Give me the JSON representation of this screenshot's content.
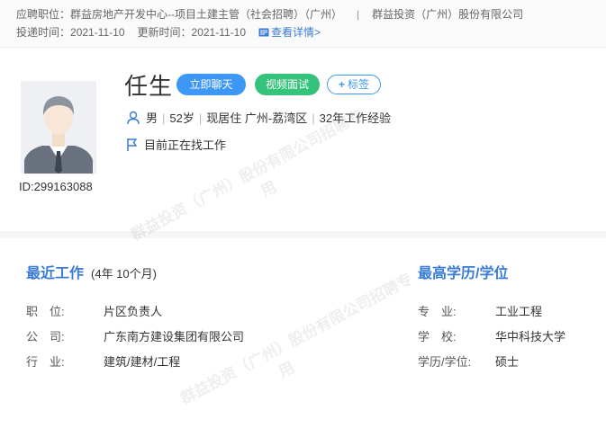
{
  "header": {
    "position_label": "应聘职位：",
    "position_value": "群益房地产开发中心--项目土建主管（社会招聘）（广州）",
    "separator": "|",
    "company": "群益投资（广州）股份有限公司",
    "submit_label": "投递时间：",
    "submit_time": "2021-11-10",
    "update_label": "更新时间：",
    "update_time": "2021-11-10",
    "detail_link": "查看详情>"
  },
  "candidate": {
    "name": "任生",
    "id_text": "ID:299163088",
    "gender": "男",
    "age": "52岁",
    "residence": "现居住 广州-荔湾区",
    "experience": "32年工作经验",
    "status": "目前正在找工作"
  },
  "actions": {
    "chat": "立即聊天",
    "video": "视频面试",
    "tag": "标签"
  },
  "recent_work": {
    "title": "最近工作",
    "duration": "(4年 10个月)",
    "rows": [
      {
        "label": "职　位:",
        "value": "片区负责人"
      },
      {
        "label": "公　司:",
        "value": "广东南方建设集团有限公司"
      },
      {
        "label": "行　业:",
        "value": "建筑/建材/工程"
      }
    ]
  },
  "education": {
    "title": "最高学历/学位",
    "rows": [
      {
        "label": "专　业:",
        "value": "工业工程"
      },
      {
        "label": "学　校:",
        "value": "华中科技大学"
      },
      {
        "label": "学历/学位:",
        "value": "硕士"
      }
    ]
  },
  "watermark": {
    "line1": "群益投资（广州）股份有限公司招聘专",
    "line2": "用"
  },
  "colors": {
    "accent": "#3a7bd5",
    "chat_button": "#3d97f5",
    "video_button": "#35c27a"
  }
}
